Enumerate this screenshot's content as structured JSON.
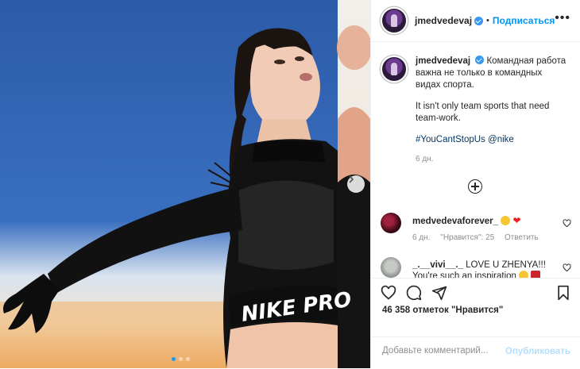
{
  "post": {
    "username": "jmedvedevaj",
    "separator": "•",
    "follow_label": "Подписаться",
    "more_label": "•••",
    "caption_ru": "Командная работа важна не только в командных видах спорта.",
    "caption_en": "It isn't only team sports that need team-work.",
    "hashtag": "#YouCantStopUs",
    "mention": "@nike",
    "age": "6 дн.",
    "likes": "46 358 отметок \"Нравится\"",
    "photo_text": "NIKE PRO",
    "carousel_total": 3,
    "carousel_active": 1
  },
  "comments": [
    {
      "username": "medvedevaforever_",
      "text": "",
      "emojis": [
        "heart-eyes-emoji",
        "red-heart-emoji"
      ],
      "age": "6 дн.",
      "likes": "\"Нравится\": 25",
      "reply": "Ответить"
    },
    {
      "username": "_.__vivi__._",
      "text": "LOVE U ZHENYA!!! You're such an inspiration",
      "emojis": [
        "heart-eyes-emoji",
        "flags-emoji"
      ]
    }
  ],
  "comment_input": {
    "placeholder": "Добавьте комментарий...",
    "value": ""
  },
  "post_button": "Опубликовать",
  "icons": {
    "like": "heart-icon",
    "comment": "comment-icon",
    "share": "paper-plane-icon",
    "save": "bookmark-icon",
    "next": "chevron-right-icon",
    "load_more": "plus-circle-icon"
  },
  "colors": {
    "accent": "#0095f6",
    "link": "#00376b",
    "muted": "#8e8e8e",
    "verified": "#3897f0"
  }
}
